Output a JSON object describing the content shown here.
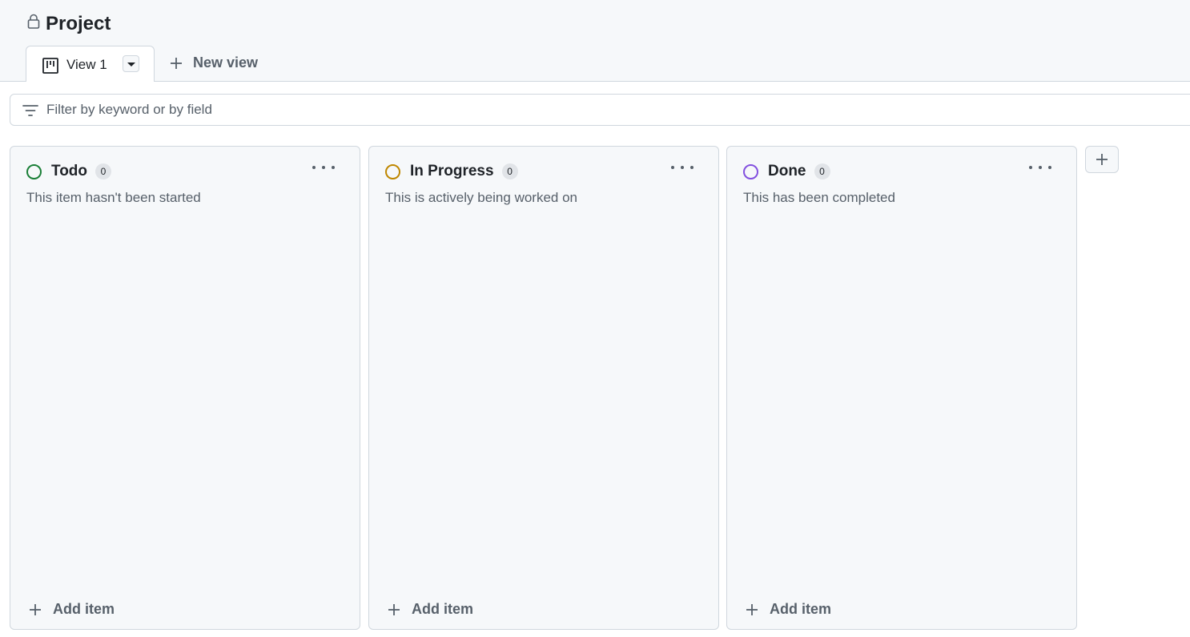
{
  "project": {
    "title": "Project"
  },
  "tabs": {
    "active_label": "View 1",
    "new_view_label": "New view"
  },
  "filter": {
    "placeholder": "Filter by keyword or by field"
  },
  "colors": {
    "todo": "#1a7f37",
    "in_progress": "#bf8700",
    "done": "#8250df",
    "muted_text": "#57606a",
    "border": "#d0d7de"
  },
  "columns": [
    {
      "name": "Todo",
      "count": "0",
      "description": "This item hasn't been started",
      "add_label": "Add item"
    },
    {
      "name": "In Progress",
      "count": "0",
      "description": "This is actively being worked on",
      "add_label": "Add item"
    },
    {
      "name": "Done",
      "count": "0",
      "description": "This has been completed",
      "add_label": "Add item"
    }
  ]
}
